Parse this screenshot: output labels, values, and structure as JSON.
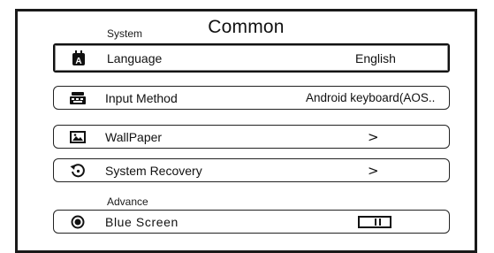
{
  "header": {
    "title": "Common"
  },
  "sections": {
    "system_label": "System",
    "advance_label": "Advance"
  },
  "rows": {
    "language": {
      "label": "Language",
      "value": "English",
      "icon": "language-icon"
    },
    "input_method": {
      "label": "Input Method",
      "value": "Android keyboard(AOS..",
      "icon": "keyboard-icon"
    },
    "wallpaper": {
      "label": "WallPaper",
      "value": ">",
      "icon": "wallpaper-icon"
    },
    "system_recovery": {
      "label": "System Recovery",
      "value": ">",
      "icon": "recovery-icon"
    },
    "blue_screen": {
      "label": "Blue Screen",
      "icon": "radio-icon",
      "toggle_on": false
    }
  }
}
